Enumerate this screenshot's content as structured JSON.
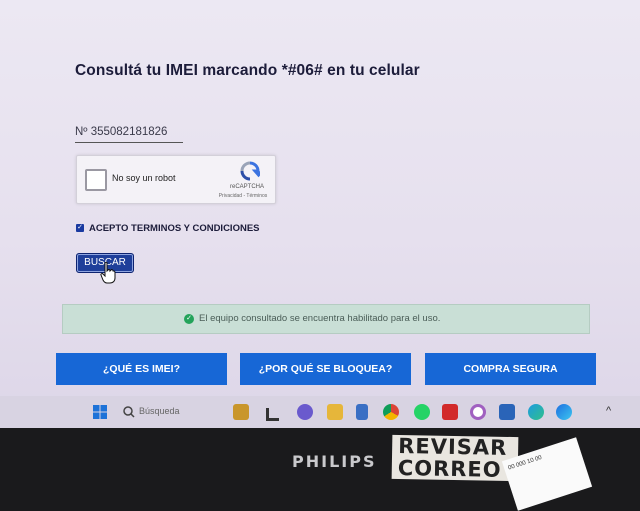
{
  "page": {
    "title": "Consultá tu IMEI marcando *#06# en tu celular",
    "imei_value": "Nº  355082181826"
  },
  "recaptcha": {
    "label": "No soy un robot",
    "brand": "reCAPTCHA",
    "links": "Privacidad - Términos"
  },
  "terms": {
    "label": "ACEPTO TERMINOS Y CONDICIONES",
    "checked": true
  },
  "search_button": {
    "label": "BUSCAR"
  },
  "status": {
    "message": "El equipo consultado se encuentra habilitado para el uso.",
    "color": "#23a35a"
  },
  "nav_buttons": [
    {
      "label": "¿QUÉ ES IMEI?"
    },
    {
      "label": "¿POR QUÉ SE BLOQUEA?"
    },
    {
      "label": "COMPRA SEGURA"
    }
  ],
  "taskbar": {
    "search_placeholder": "Búsqueda",
    "icons": [
      "windows-logo-icon",
      "search-icon",
      "lunch-icon",
      "file-explorer-icon",
      "teams-icon",
      "folder-icon",
      "notepad-icon",
      "chrome-icon",
      "whatsapp-icon",
      "acrobat-icon",
      "app-icon",
      "clock-icon",
      "edge-icon",
      "edge-beta-icon"
    ]
  },
  "monitor": {
    "brand": "PHILIPS",
    "sticker_text": "REVISAR CORREO",
    "label_text": "00 000 10 00"
  },
  "colors": {
    "accent": "#1767d6",
    "button_dark": "#1f3f9a",
    "title": "#1c1c3a"
  }
}
